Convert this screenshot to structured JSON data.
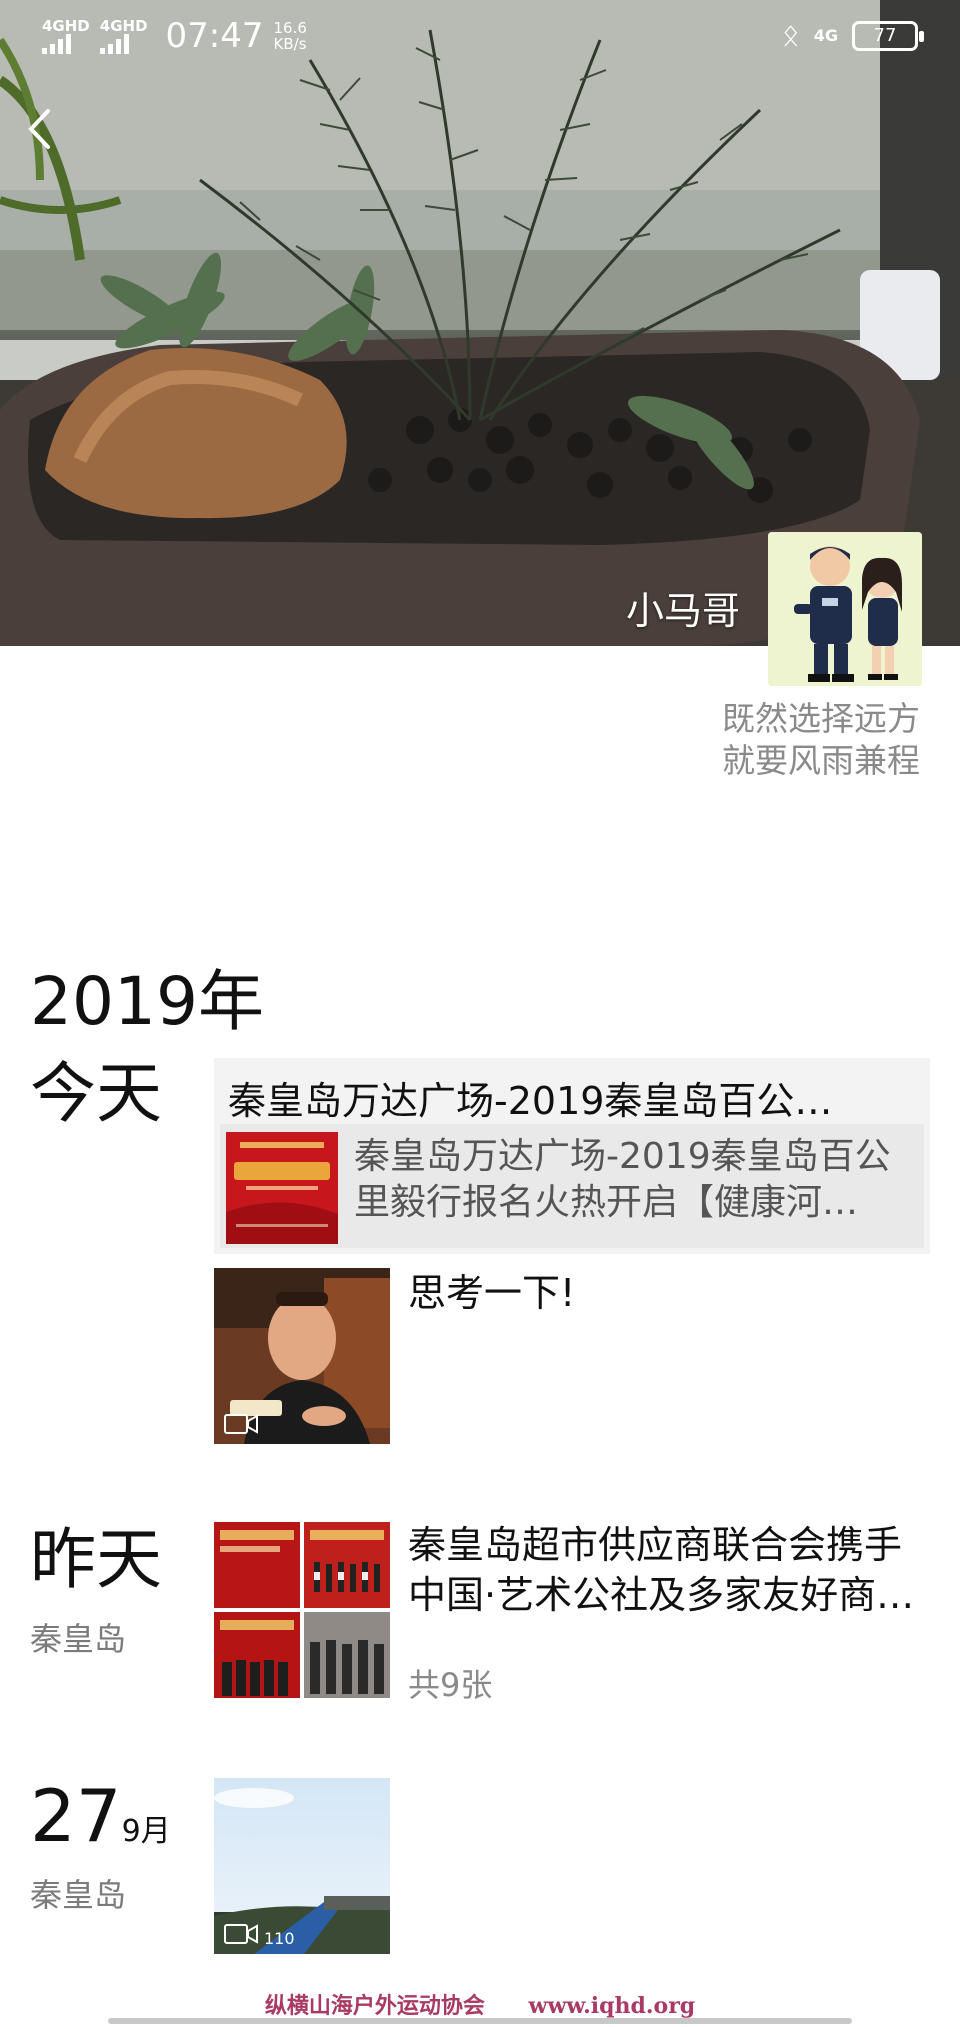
{
  "status_bar": {
    "network1": "4GHD",
    "network2": "4GHD",
    "time": "07:47",
    "speed_value": "16.6",
    "speed_unit": "KB/s",
    "network_right": "4G",
    "battery": "77"
  },
  "profile": {
    "username": "小马哥",
    "signature_line1": "既然选择远方",
    "signature_line2": "就要风雨兼程"
  },
  "feed": {
    "year": "2019年",
    "groups": [
      {
        "date": "今天",
        "share": {
          "title": "秦皇岛万达广场-2019秦皇岛百公…",
          "link_line1": "秦皇岛万达广场-2019秦皇岛百公",
          "link_line2": "里毅行报名火热开启【健康河…"
        },
        "video_post": {
          "text": "思考一下!"
        }
      },
      {
        "date": "昨天",
        "location": "秦皇岛",
        "photo_post": {
          "line1": "秦皇岛超市供应商联合会携手",
          "line2": "中国·艺术公社及多家友好商…",
          "count": "共9张"
        }
      },
      {
        "day": "27",
        "month": "9月",
        "location": "秦皇岛",
        "video_caption": "110"
      }
    ]
  },
  "watermark": {
    "org": "纵横山海户外运动协会",
    "url": "www.iqhd.org"
  },
  "colors": {
    "watermark": "#a93a64",
    "secondary_text": "#8a8a8a",
    "card_bg": "#f3f3f3"
  }
}
